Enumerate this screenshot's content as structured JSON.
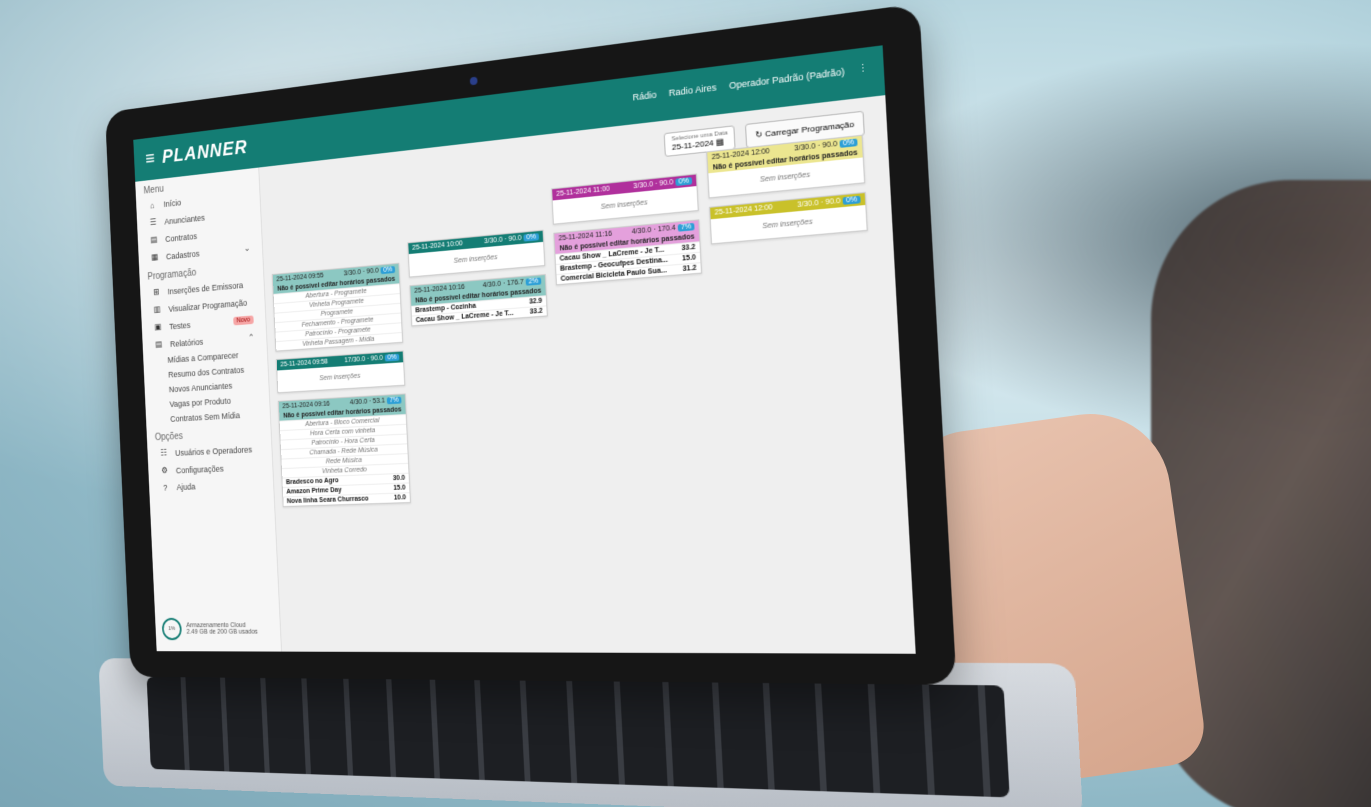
{
  "app": {
    "brand": "PLANNER",
    "topbar": {
      "user_area": "Rádio",
      "radio": "Radio Aires",
      "user": "Operador Padrão (Padrão)"
    }
  },
  "sidebar": {
    "menu_title": "Menu",
    "items": [
      {
        "label": "Início",
        "icon": "home-icon"
      },
      {
        "label": "Anunciantes",
        "icon": "users-icon"
      },
      {
        "label": "Contratos",
        "icon": "document-icon"
      },
      {
        "label": "Cadastros",
        "icon": "list-icon"
      }
    ],
    "prog_title": "Programação",
    "prog_items": [
      {
        "label": "Inserções de Emissora",
        "icon": "insert-icon"
      },
      {
        "label": "Visualizar Programação",
        "icon": "calendar-view-icon"
      },
      {
        "label": "Testes",
        "icon": "calendar-icon",
        "badge": "Novo"
      },
      {
        "label": "Relatórios",
        "icon": "report-icon"
      }
    ],
    "report_items": [
      "Mídias a Comparecer",
      "Resumo dos Contratos",
      "Novos Anunciantes",
      "Vagas por Produto",
      "Contratos Sem Mídia"
    ],
    "options_title": "Opções",
    "option_items": [
      {
        "label": "Usuários e Operadores",
        "icon": "people-icon"
      },
      {
        "label": "Configurações",
        "icon": "gear-icon"
      },
      {
        "label": "Ajuda",
        "icon": "help-icon"
      }
    ],
    "storage": {
      "percent": "1%",
      "title": "Armazenamento Cloud",
      "usage": "2.49 GB de 200 GB usados"
    }
  },
  "controls": {
    "date_label": "Selecione uma Data",
    "date_value": "25-11-2024",
    "load_button": "Carregar Programação"
  },
  "cards": {
    "warn": "Não é possível editar horários passados",
    "empty": "Sem inserções",
    "c1": {
      "time": "25-11-2024 09:55",
      "val": "3/30.0 · 90.0",
      "pct": "0%",
      "rows": [
        "Abertura - Programete",
        "Vinheta Programete",
        "Programete",
        "Fechamento - Programete",
        "Patrocínio - Programete",
        "Vinheta Passagem - Mídia"
      ]
    },
    "c2": {
      "time": "25-11-2024 09:58",
      "val": "17/30.0 · 90.0",
      "pct": "0%"
    },
    "c3": {
      "time": "25-11-2024 09:16",
      "val": "4/30.0 · 53.1",
      "pct": "7%",
      "rows": [
        "Abertura - Bloco Comercial",
        "Hora Certa com vinheta",
        "Patrocínio - Hora Certa",
        "Chamada - Rede Música",
        "Rede Música",
        "Vinheta Corredo"
      ],
      "ads": [
        [
          "Bradesco no Agro",
          "30.0"
        ],
        [
          "Amazon Prime Day",
          "15.0"
        ],
        [
          "Nova linha Seara Churrasco",
          "10.0"
        ]
      ]
    },
    "c4": {
      "time": "25-11-2024 10:00",
      "val": "3/30.0 · 90.0",
      "pct": "0%"
    },
    "c5": {
      "time": "25-11-2024 10:16",
      "val": "4/30.0 · 176.7",
      "pct": "2%",
      "ads": [
        [
          "Brastemp - Cozinha",
          "32.9"
        ],
        [
          "Cacau Show _ LaCreme - Je T...",
          "33.2"
        ]
      ]
    },
    "c6": {
      "time": "25-11-2024 11:00",
      "val": "3/30.0 · 90.0",
      "pct": "0%"
    },
    "c7": {
      "time": "25-11-2024 11:16",
      "val": "4/30.0 · 170.4",
      "pct": "7%",
      "ads": [
        [
          "Cacau Show _ LaCreme - Je T...",
          "33.2"
        ],
        [
          "Brastemp - Geocufpes Destina...",
          "15.0"
        ],
        [
          "Comercial Bicicleta Paulo Sua...",
          "31.2"
        ]
      ]
    },
    "c8": {
      "time": "25-11-2024 12:00",
      "val": "3/30.0 · 90.0",
      "pct": "0%"
    },
    "c9": {
      "time": "25-11-2024 12:00",
      "val": "3/30.0 · 90.0",
      "pct": "0%"
    }
  }
}
